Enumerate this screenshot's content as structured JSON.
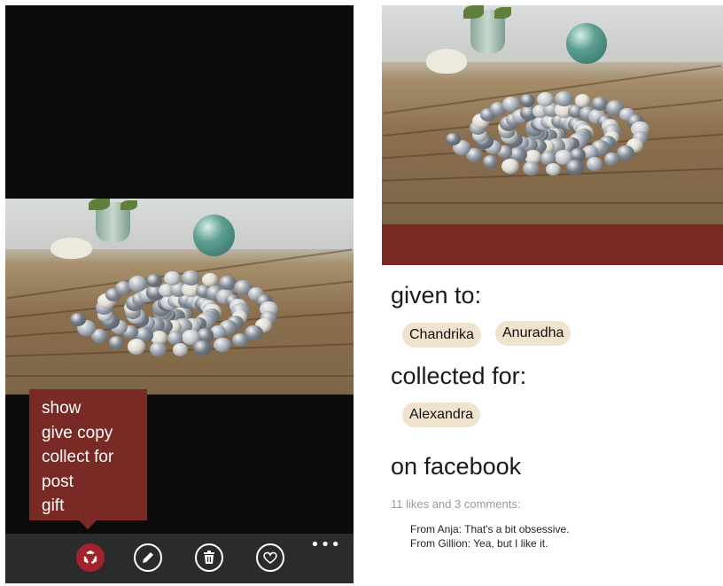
{
  "left_screen": {
    "context_menu": {
      "items": [
        "show",
        "give copy",
        "collect for",
        "post",
        "gift"
      ]
    },
    "app_bar": {
      "buttons": [
        {
          "icon": "share-icon",
          "active": true
        },
        {
          "icon": "edit-icon",
          "active": false
        },
        {
          "icon": "delete-icon",
          "active": false
        },
        {
          "icon": "heart-icon",
          "active": false
        }
      ],
      "more_label": "•••"
    }
  },
  "right_screen": {
    "given_to": {
      "heading": "given to:",
      "people": [
        "Chandrika",
        "Anuradha"
      ]
    },
    "collected_for": {
      "heading": "collected for:",
      "people": [
        "Alexandra"
      ]
    },
    "facebook": {
      "heading": "on facebook",
      "stats": "11 likes and 3 comments:",
      "comments": [
        "From Anja: That's a bit obsessive.",
        "From Gillion: Yea, but I like it."
      ]
    }
  },
  "colors": {
    "accent": "#7a2a24",
    "active_button": "#a3232c",
    "chip": "#efe3cd",
    "app_bar": "#2b2b2b"
  }
}
